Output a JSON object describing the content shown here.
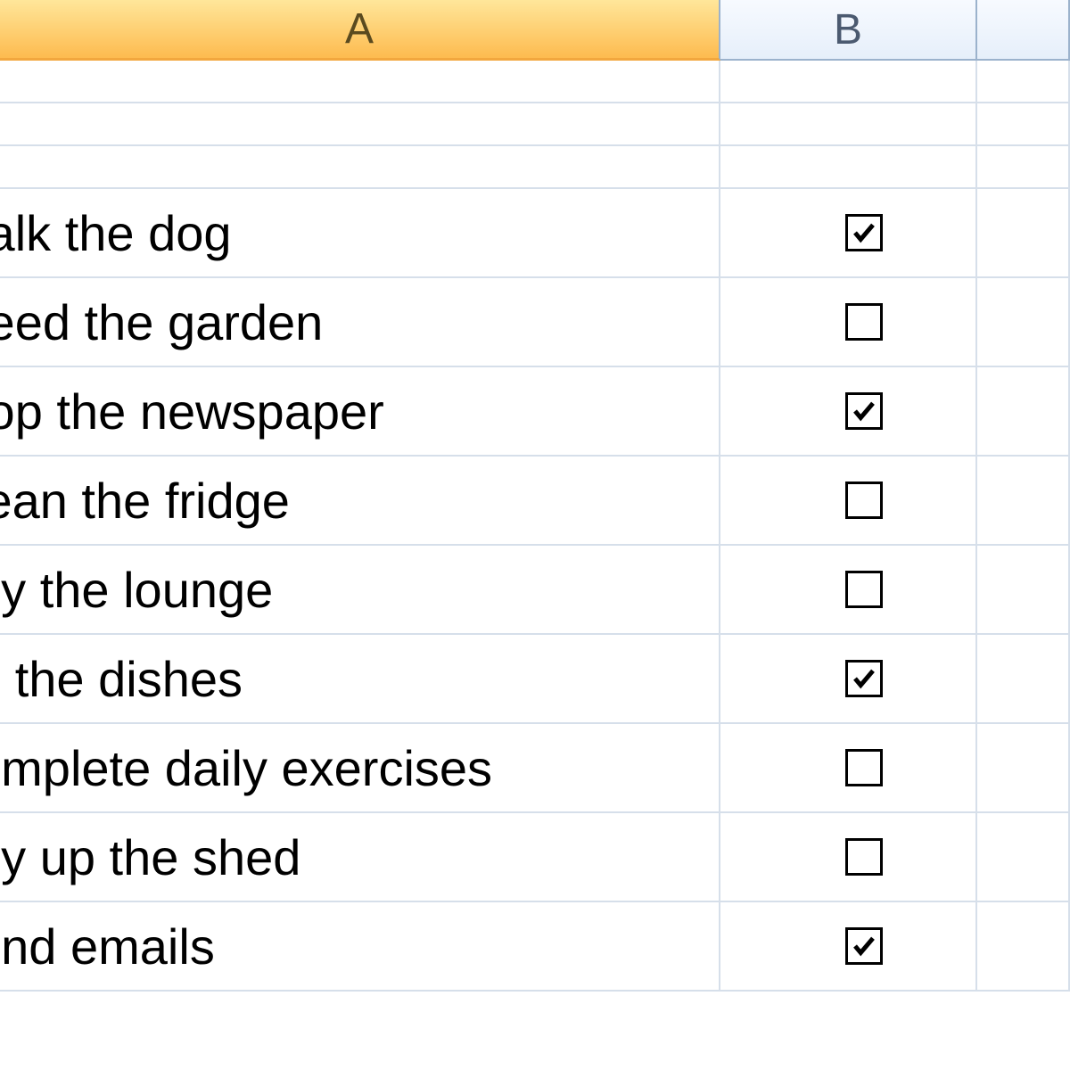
{
  "columns": {
    "a": "A",
    "b": "B",
    "c": ""
  },
  "rows": [
    {
      "text": "",
      "checkbox": null,
      "tall": false
    },
    {
      "text": "",
      "checkbox": null,
      "tall": false
    },
    {
      "text": "",
      "checkbox": null,
      "tall": false
    },
    {
      "text": "/alk the dog",
      "checkbox": true,
      "tall": true
    },
    {
      "text": "/eed the garden",
      "checkbox": false,
      "tall": true
    },
    {
      "text": "top the newspaper",
      "checkbox": true,
      "tall": true
    },
    {
      "text": "lean the fridge",
      "checkbox": false,
      "tall": true
    },
    {
      "text": "dy the lounge",
      "checkbox": false,
      "tall": true
    },
    {
      "text": "o the dishes",
      "checkbox": true,
      "tall": true
    },
    {
      "text": "omplete daily exercises",
      "checkbox": false,
      "tall": true
    },
    {
      "text": "dy up the shed",
      "checkbox": false,
      "tall": true
    },
    {
      "text": "end emails",
      "checkbox": true,
      "tall": true
    }
  ]
}
